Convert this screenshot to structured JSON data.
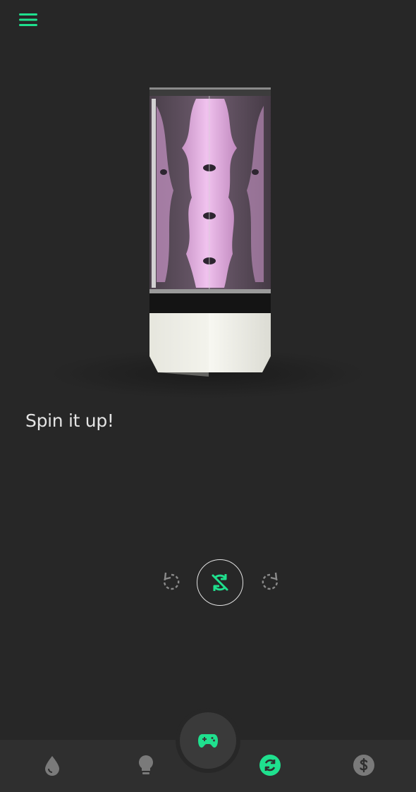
{
  "header": {
    "menu_icon": "hamburger-menu-icon"
  },
  "hero": {
    "image": "hydroponic-tower-render"
  },
  "main": {
    "title": "Spin it up!"
  },
  "controls": {
    "rotate_left_icon": "rotate-left-icon",
    "center_icon": "sync-disabled-icon",
    "rotate_right_icon": "rotate-right-icon"
  },
  "bottom_nav": {
    "items": [
      {
        "icon": "water-drop-icon",
        "active": false
      },
      {
        "icon": "lightbulb-icon",
        "active": false
      },
      {
        "icon": "sync-icon",
        "active": true
      },
      {
        "icon": "dollar-icon",
        "active": false
      }
    ],
    "fab_icon": "gamepad-icon"
  },
  "colors": {
    "background": "#272727",
    "nav_background": "#2f2f2f",
    "accent": "#1fe08e",
    "inactive_icon": "#7a7a7a",
    "text": "#e4e4e4",
    "tower_pink": "#e9b2e6"
  }
}
